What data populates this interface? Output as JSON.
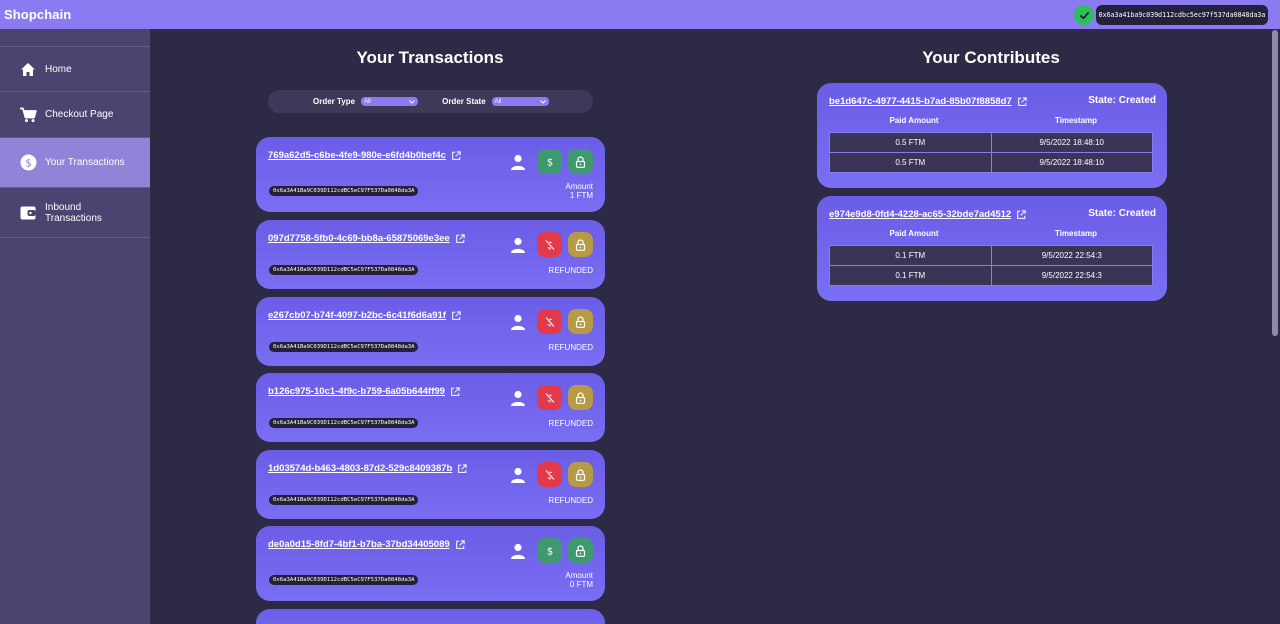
{
  "app": {
    "title": "Shopchain"
  },
  "wallet": {
    "address": "0x6a3a41ba9c039d112cdbc5ec97f537da0848da3a",
    "connected_icon": "check-icon"
  },
  "sidebar": {
    "items": [
      {
        "label": "Home",
        "icon": "home-icon"
      },
      {
        "label": "Checkout Page",
        "icon": "cart-icon"
      },
      {
        "label": "Your Transactions",
        "icon": "dollar-circle-icon",
        "active": true
      },
      {
        "label": "Inbound Transactions",
        "icon": "wallet-icon"
      }
    ]
  },
  "transactions": {
    "title": "Your Transactions",
    "filters": {
      "order_type": {
        "label": "Order Type",
        "value": "All"
      },
      "order_state": {
        "label": "Order State",
        "value": "All"
      }
    },
    "items": [
      {
        "id": "769a62d5-c6be-4fe9-980e-e6fd4b0bef4c",
        "address": "0x6a3A41Ba9C039D112cdBC5eC97F537Da0848da3A",
        "status_line1": "Amount",
        "status_line2": "1 FTM",
        "mid_button": "dollar"
      },
      {
        "id": "097d7758-5fb0-4c69-bb8a-65875069e3ee",
        "address": "0x6a3A41Ba9C039D112cdBC5eC97F537Da0848da3A",
        "status_line1": "REFUNDED",
        "status_line2": "",
        "mid_button": "no-dollar"
      },
      {
        "id": "e267cb07-b74f-4097-b2bc-6c41f6d6a91f",
        "address": "0x6a3A41Ba9C039D112cdBC5eC97F537Da0848da3A",
        "status_line1": "REFUNDED",
        "status_line2": "",
        "mid_button": "no-dollar"
      },
      {
        "id": "b126c975-10c1-4f9c-b759-6a05b644ff99",
        "address": "0x6a3A41Ba9C039D112cdBC5eC97F537Da0848da3A",
        "status_line1": "REFUNDED",
        "status_line2": "",
        "mid_button": "no-dollar"
      },
      {
        "id": "1d03574d-b463-4803-87d2-529c8409387b",
        "address": "0x6a3A41Ba9C039D112cdBC5eC97F537Da0848da3A",
        "status_line1": "REFUNDED",
        "status_line2": "",
        "mid_button": "no-dollar"
      },
      {
        "id": "de0a0d15-8fd7-4bf1-b7ba-37bd34405089",
        "address": "0x6a3A41Ba9C039D112cdBC5eC97F537Da0848da3A",
        "status_line1": "Amount",
        "status_line2": "0 FTM",
        "mid_button": "dollar"
      }
    ]
  },
  "contributes": {
    "title": "Your Contributes",
    "col_paid": "Paid Amount",
    "col_timestamp": "Timestamp",
    "items": [
      {
        "id": "be1d647c-4977-4415-b7ad-85b07f8858d7",
        "state": "State: Created",
        "rows": [
          {
            "amount": "0.5 FTM",
            "timestamp": "9/5/2022 18:48:10"
          },
          {
            "amount": "0.5 FTM",
            "timestamp": "9/5/2022 18:48:10"
          }
        ]
      },
      {
        "id": "e974e9d8-0fd4-4228-ac65-32bde7ad4512",
        "state": "State: Created",
        "rows": [
          {
            "amount": "0.1 FTM",
            "timestamp": "9/5/2022 22:54:3"
          },
          {
            "amount": "0.1 FTM",
            "timestamp": "9/5/2022 22:54:3"
          }
        ]
      }
    ]
  },
  "colors": {
    "accent": "#8a7bf2",
    "card": "#7066ec",
    "sidebar": "#4a4570",
    "background": "#2c2a45",
    "green": "#3e9a6e",
    "red": "#e23a4a",
    "gold": "#b79a45"
  }
}
